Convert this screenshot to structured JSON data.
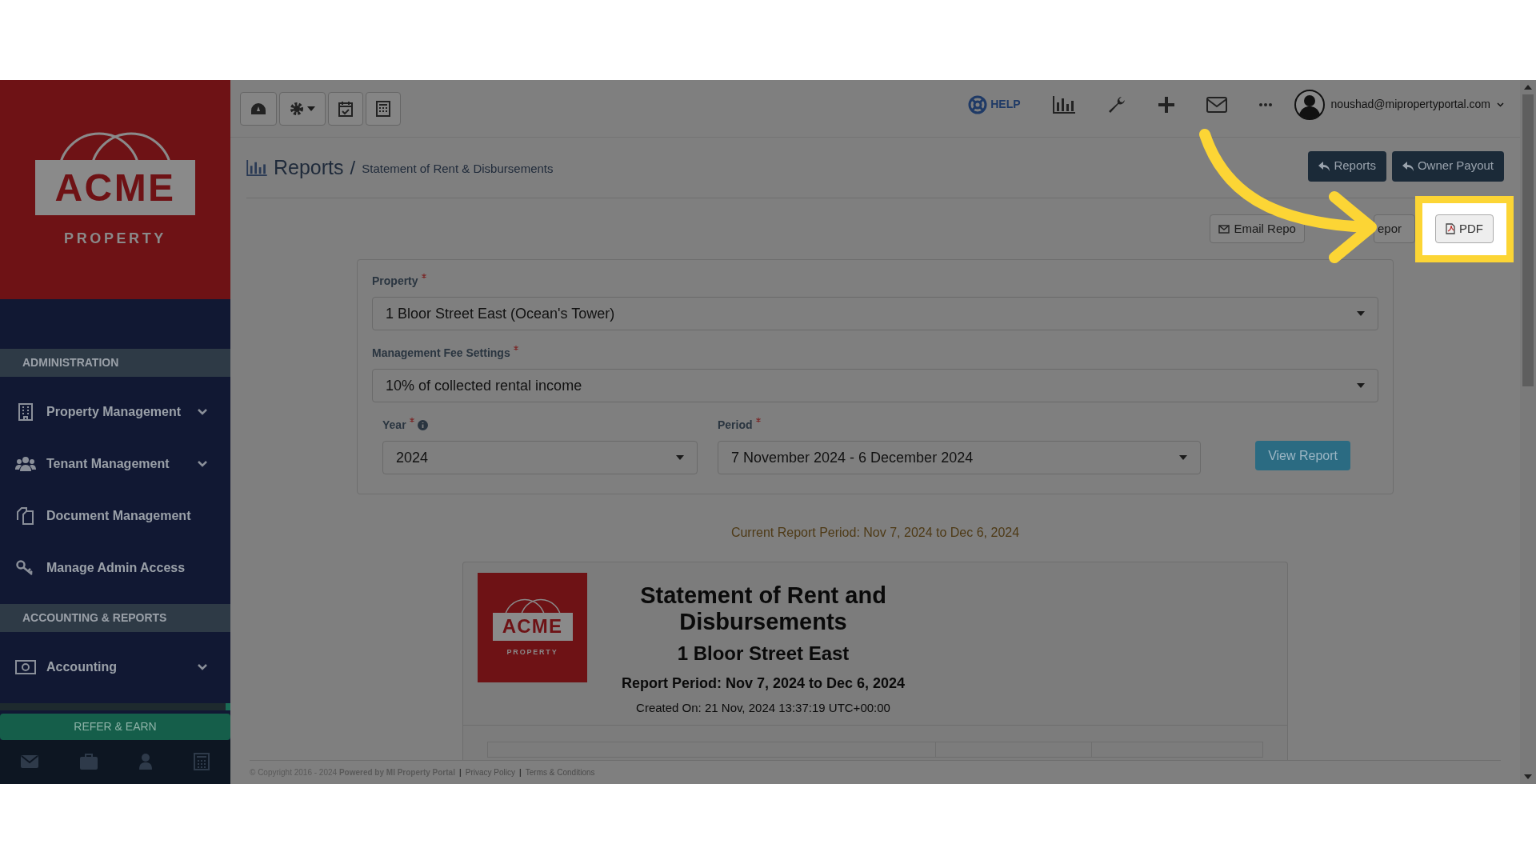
{
  "logo": {
    "brand": "ACME",
    "tagline": "PROPERTY"
  },
  "sidebar": {
    "sections": [
      {
        "title": "ADMINISTRATION",
        "items": [
          {
            "label": "Property Management",
            "kind": "building",
            "has_submenu": true
          },
          {
            "label": "Tenant Management",
            "kind": "users",
            "has_submenu": true
          },
          {
            "label": "Document Management",
            "kind": "documents",
            "has_submenu": false
          },
          {
            "label": "Manage Admin Access",
            "kind": "key",
            "has_submenu": false
          }
        ]
      },
      {
        "title": "ACCOUNTING & REPORTS",
        "items": [
          {
            "label": "Accounting",
            "kind": "money",
            "has_submenu": true
          }
        ]
      }
    ],
    "refer_button": "REFER & EARN"
  },
  "topnav": {
    "help": "HELP",
    "user": "noushad@mipropertyportal.com"
  },
  "breadcrumb": {
    "title": "Reports",
    "separator": "/",
    "current": "Statement of Rent & Disbursements"
  },
  "header_buttons": [
    {
      "label": "Reports"
    },
    {
      "label": "Owner Payout"
    }
  ],
  "report_buttons": [
    {
      "label": "Email Repo",
      "kind": "email",
      "highlighted": false
    },
    {
      "label": "epor",
      "kind": "plain",
      "highlighted": false
    },
    {
      "label": "PDF",
      "kind": "pdf",
      "highlighted": true
    }
  ],
  "form": {
    "property": {
      "label": "Property",
      "required": true,
      "value": "1 Bloor Street East (Ocean's Tower)"
    },
    "fee": {
      "label": "Management Fee Settings",
      "required": true,
      "value": "10% of collected rental income"
    },
    "year": {
      "label": "Year",
      "required": true,
      "value": "2024"
    },
    "period": {
      "label": "Period",
      "required": true,
      "value": "7 November 2024 - 6 December 2024"
    },
    "submit": "View Report"
  },
  "current_period": "Current Report Period: Nov 7, 2024 to Dec 6, 2024",
  "report": {
    "logo_brand": "ACME",
    "logo_tagline": "PROPERTY",
    "title": "Statement of Rent and Disbursements",
    "property": "1 Bloor Street East",
    "period": "Report Period: Nov 7, 2024 to Dec 6, 2024",
    "created": "Created On: 21 Nov, 2024 13:37:19 UTC+00:00"
  },
  "footer": {
    "copyright": "© Copyright 2016 - 2024 **Powered by MI Property Portal**",
    "items": [
      {
        "kind": "separator",
        "text": "|"
      },
      {
        "kind": "link",
        "text": "Privacy Policy"
      },
      {
        "kind": "separator",
        "text": "|"
      },
      {
        "kind": "link",
        "text": "Terms & Conditions"
      }
    ]
  }
}
